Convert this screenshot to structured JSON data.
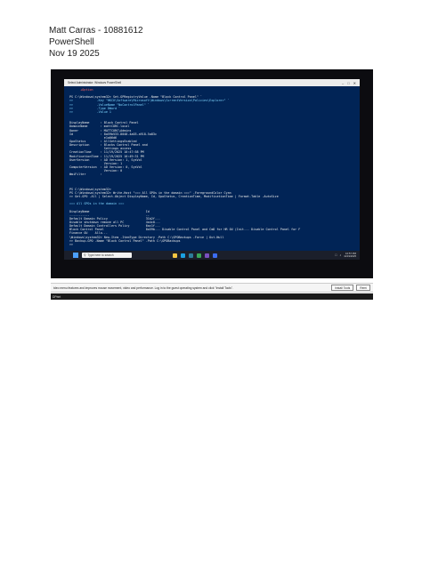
{
  "header": {
    "name_line": "Matt Carras - 10881612",
    "subject": "PowerShell",
    "date": "Nov 19 2025"
  },
  "window": {
    "title": "Select Administrator: Windows PowerShell"
  },
  "console": {
    "lines": [
      {
        "text": "      +Option",
        "style": "error"
      },
      {
        "text": "",
        "style": "normal"
      },
      {
        "text": "PS C:\\Windows\\system32> Set-GPRegistryValue -Name \"Block Control Panel\" `",
        "style": "normal"
      },
      {
        "text": ">>             -Key \"HKCU\\Software\\Microsoft\\Windows\\CurrentVersion\\Policies\\Explorer\" `",
        "style": "accent"
      },
      {
        "text": ">>             -ValueName \"NoControlPanel\" `",
        "style": "accent"
      },
      {
        "text": ">>             -Type DWord `",
        "style": "accent"
      },
      {
        "text": ">>             -Value 1",
        "style": "accent"
      },
      {
        "text": "",
        "style": "normal"
      },
      {
        "text": "",
        "style": "normal"
      },
      {
        "text": "DisplayName      : Block Control Panel",
        "style": "normal"
      },
      {
        "text": "DomainName       : mattCORC.local",
        "style": "normal"
      },
      {
        "text": "Owner            : MATTCORC\\Admins",
        "style": "normal"
      },
      {
        "text": "Id               : 8a59b533-8048-4a03-a918-5a83c",
        "style": "normal"
      },
      {
        "text": "                   e1a06d6",
        "style": "normal"
      },
      {
        "text": "GpoStatus        : AllSettingsEnabled",
        "style": "normal"
      },
      {
        "text": "Description      : Blocks Control Panel and",
        "style": "normal"
      },
      {
        "text": "                   Settings access",
        "style": "normal"
      },
      {
        "text": "CreationTime     : 11/19/2025 10:47:58 PM",
        "style": "normal"
      },
      {
        "text": "ModificationTime : 11/19/2025 10:49:31 PM",
        "style": "normal"
      },
      {
        "text": "UserVersion      : AD Version: 1, SysVol",
        "style": "normal"
      },
      {
        "text": "                   Version: 1",
        "style": "normal"
      },
      {
        "text": "ComputerVersion  : AD Version: 0, SysVol",
        "style": "normal"
      },
      {
        "text": "                   Version: 0",
        "style": "normal"
      },
      {
        "text": "WmiFilter        :",
        "style": "normal"
      },
      {
        "text": "",
        "style": "normal"
      },
      {
        "text": "",
        "style": "normal"
      },
      {
        "text": "",
        "style": "normal"
      },
      {
        "text": "PS C:\\Windows\\system32>",
        "style": "normal"
      },
      {
        "text": "PS C:\\Windows\\system32> Write-Host \"=== All GPOs in the domain ===\" -ForegroundColor Cyan",
        "style": "normal"
      },
      {
        "text": ">> Get-GPO -All | Select-Object DisplayName, Id, GpoStatus, CreationTime, ModificationTime | Format-Table -AutoSize",
        "style": "normal"
      },
      {
        "text": "",
        "style": "normal"
      },
      {
        "text": "=== All GPOs in the domain ===",
        "style": "accent"
      },
      {
        "text": "",
        "style": "normal"
      },
      {
        "text": "DisplayName                               Id",
        "style": "normal"
      },
      {
        "text": "-----------                               --",
        "style": "normal"
      },
      {
        "text": "Default Domain Policy                     31b2f...",
        "style": "normal"
      },
      {
        "text": "Disable shutdown remove all PC            4a4c0...",
        "style": "normal"
      },
      {
        "text": "Default Domain Controllers Policy         6ac1f...",
        "style": "normal"
      },
      {
        "text": "Block Control Panel                       8a59b... Disable Control Panel and CmD for HR OU (Init... Disable Control Panel for F",
        "style": "normal"
      },
      {
        "text": "Finance OU    Allo...",
        "style": "normal"
      },
      {
        "text": "\\Windows\\system32> New-Item -ItemType Directory -Path C:\\GPOBackups -Force | Out-Null",
        "style": "normal"
      },
      {
        "text": ">> Backup-GPO -Name \"Block Control Panel\" -Path C:\\GPOBackups",
        "style": "normal"
      },
      {
        "text": ">>",
        "style": "normal"
      }
    ]
  },
  "taskbar": {
    "search_placeholder": "Type here to search",
    "search_icon": "search-icon",
    "clock_time": "10:57 PM",
    "clock_date": "11/19/2025",
    "app_colors": [
      "#f4c542",
      "#1ba1e2",
      "#2d7d9a",
      "#3aa757",
      "#7a4fbf",
      "#3c6df0"
    ]
  },
  "notice": {
    "text": "tdeo menu features and improves mouse movement, video and performance. Log in to the guest operating system and click \"Install Tools\".",
    "install_label": "Install Tools",
    "remind_label": "Remi"
  },
  "bottom": {
    "label": "DPrint"
  }
}
